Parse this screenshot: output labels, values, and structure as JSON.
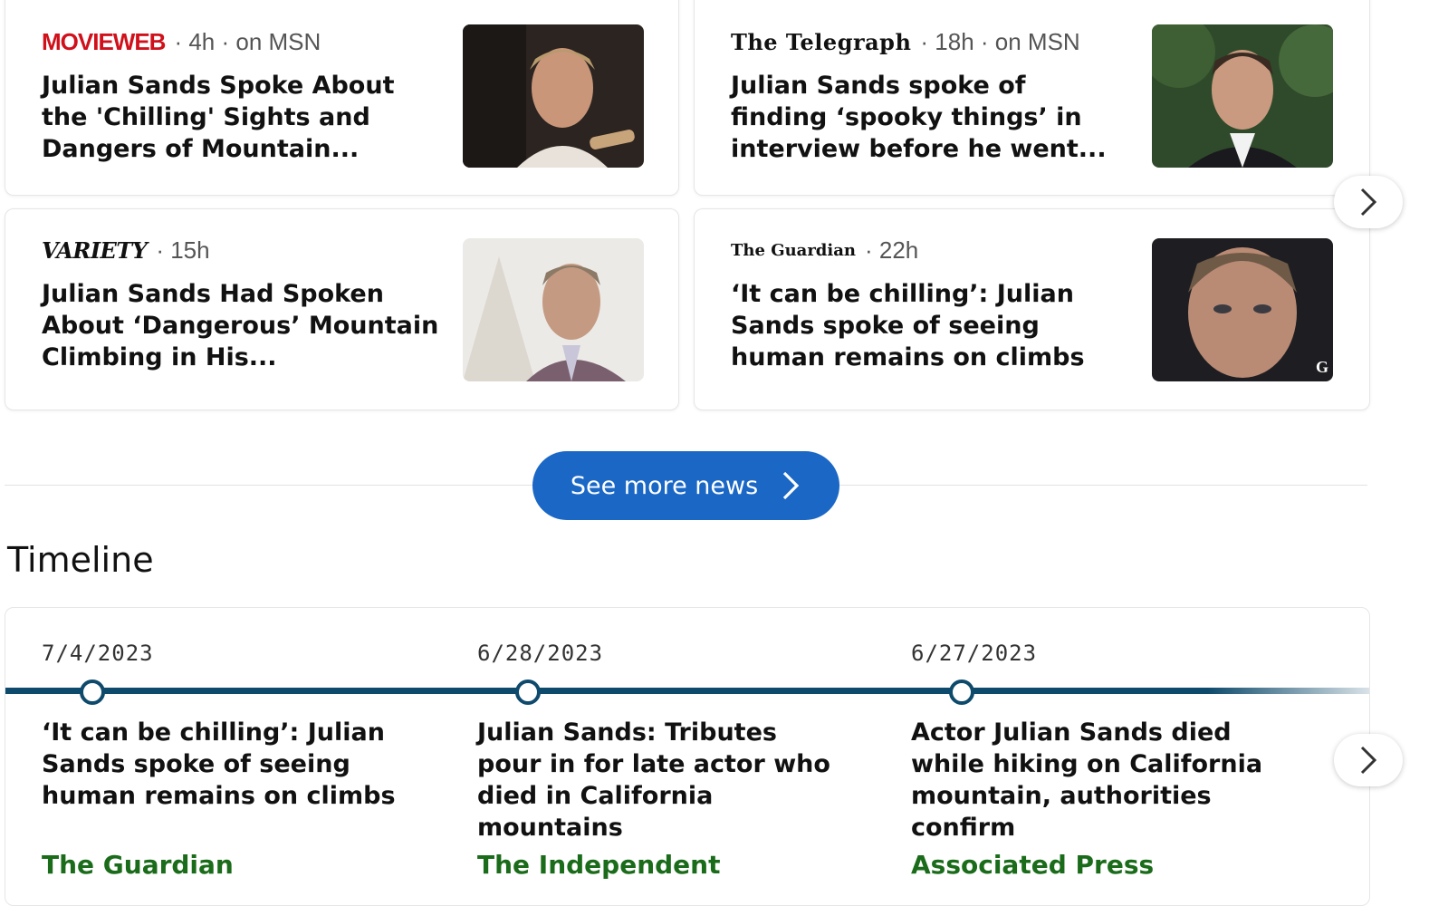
{
  "news_cards": [
    {
      "source": "MOVIEWEB",
      "meta": "· 4h · on MSN",
      "headline": "Julian Sands Spoke About the 'Chilling' Sights and Dangers of Mountain..."
    },
    {
      "source": "The Telegraph",
      "meta": "· 18h · on MSN",
      "headline": "Julian Sands spoke of finding ‘spooky things’ in interview before he went..."
    },
    {
      "source": "VARIETY",
      "meta": "· 15h",
      "headline": "Julian Sands Had Spoken About ‘Dangerous’ Mountain Climbing in His..."
    },
    {
      "source": "The Guardian",
      "meta": "· 22h",
      "headline": "‘It can be chilling’: Julian Sands spoke of seeing human remains on climbs"
    }
  ],
  "see_more": {
    "label": "See more news"
  },
  "timeline": {
    "title": "Timeline",
    "items": [
      {
        "date": "7/4/2023",
        "headline": "‘It can be chilling’: Julian Sands spoke of seeing human remains on climbs",
        "source": "The Guardian"
      },
      {
        "date": "6/28/2023",
        "headline": "Julian Sands: Tributes pour in for late actor who died in California mountains",
        "source": "The Independent"
      },
      {
        "date": "6/27/2023",
        "headline": "Actor Julian Sands died while hiking on California mountain, authorities confirm",
        "source": "Associated Press"
      }
    ]
  },
  "colors": {
    "accent": "#1a67c5",
    "timeline": "#0e4a6b",
    "source_green": "#1a6b1a"
  }
}
